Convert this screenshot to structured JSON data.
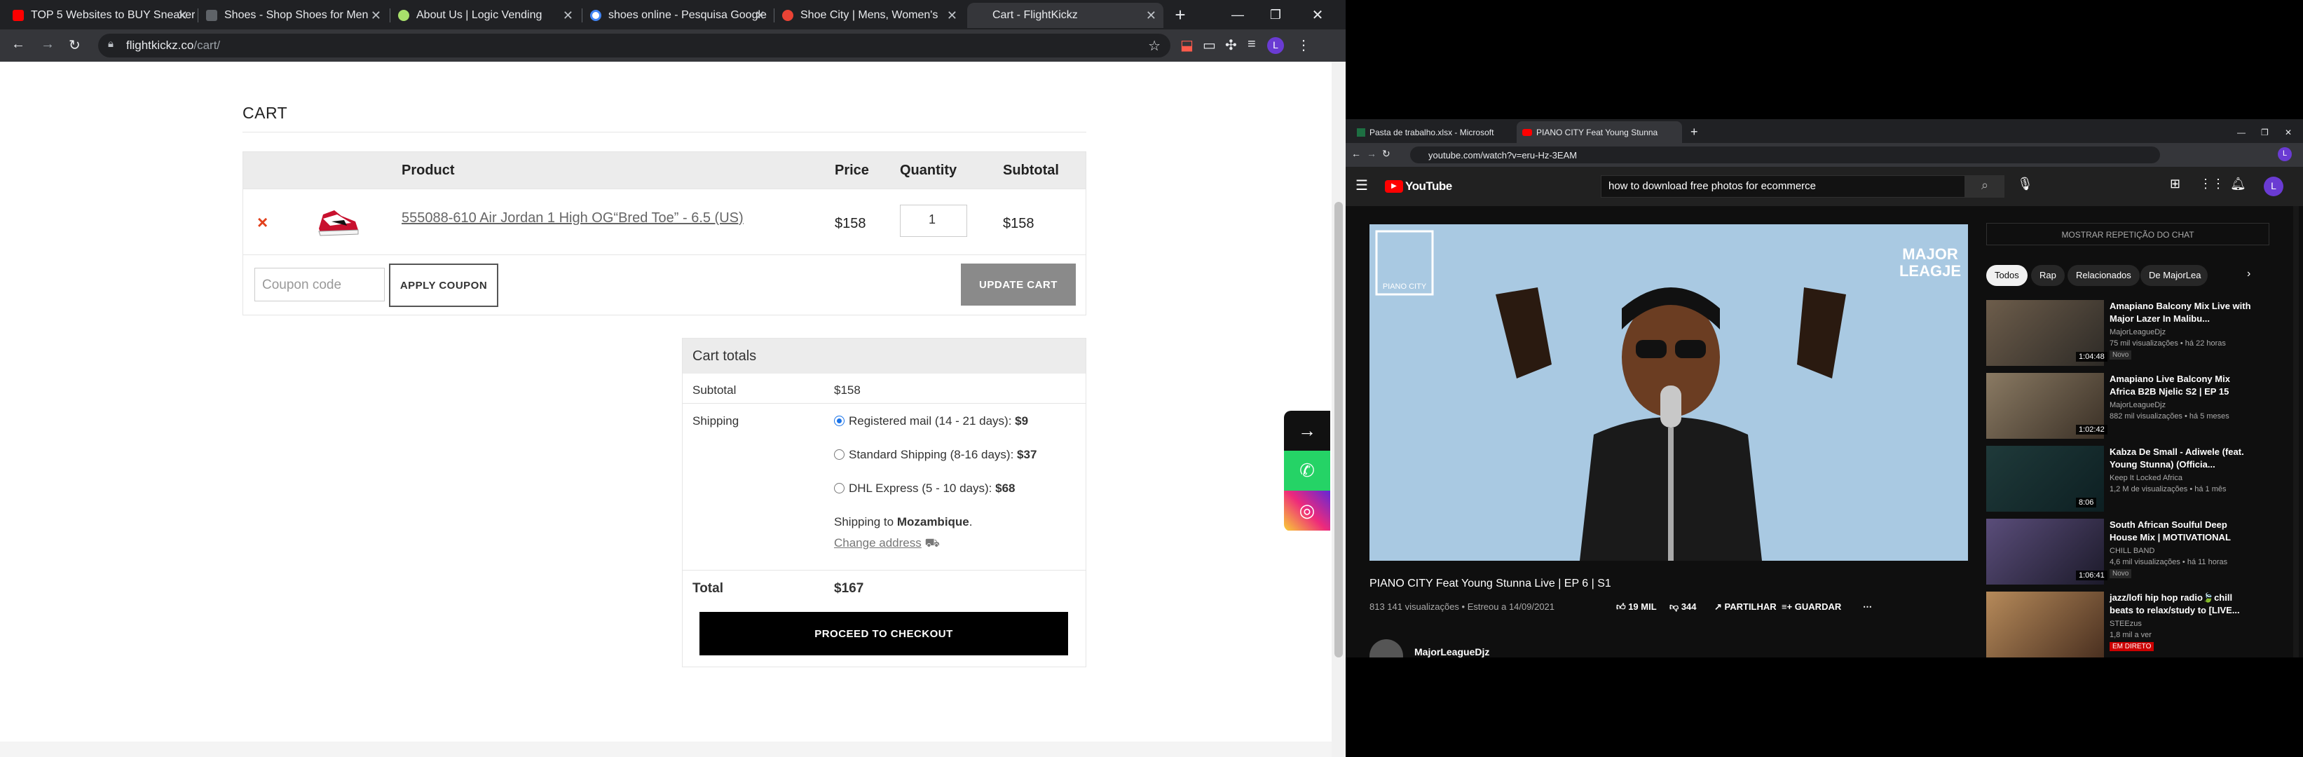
{
  "browser": {
    "tabs": [
      {
        "title": "TOP 5 Websites to BUY Sneakers",
        "color": "#ff0000"
      },
      {
        "title": "Shoes - Shop Shoes for Men",
        "color": "#5f6368"
      },
      {
        "title": "About Us | Logic Vending",
        "color": "#a8e06b"
      },
      {
        "title": "shoes online - Pesquisa Google",
        "color": "#4285f4"
      },
      {
        "title": "Shoe City | Mens, Women's",
        "color": "#ea4335"
      },
      {
        "title": "Cart - FlightKickz",
        "color": ""
      }
    ],
    "url_host": "flightkickz.co",
    "url_path": "/cart/",
    "profile_initial": "L"
  },
  "cart": {
    "title": "CART",
    "headers": {
      "product": "Product",
      "price": "Price",
      "quantity": "Quantity",
      "subtotal": "Subtotal"
    },
    "item": {
      "remove": "×",
      "name": "555088-610 Air Jordan 1 High OG“Bred Toe” - 6.5 (US)",
      "price": "$158",
      "quantity": "1",
      "subtotal": "$158"
    },
    "coupon_placeholder": "Coupon code",
    "apply_label": "APPLY COUPON",
    "update_label": "UPDATE CART"
  },
  "totals": {
    "title": "Cart totals",
    "subtotal_label": "Subtotal",
    "subtotal": "$158",
    "shipping_label": "Shipping",
    "options": [
      {
        "name": "Registered mail (14 - 21 days):",
        "price": "$9",
        "selected": true
      },
      {
        "name": "Standard Shipping (8-16 days):",
        "price": "$37",
        "selected": false
      },
      {
        "name": "DHL Express (5 - 10 days):",
        "price": "$68",
        "selected": false
      }
    ],
    "ship_to_prefix": "Shipping to",
    "ship_to_country": "Mozambique",
    "change_address": "Change address",
    "total_label": "Total",
    "total": "$167",
    "checkout_label": "PROCEED TO CHECKOUT"
  },
  "win2": {
    "tabs": [
      "Pasta de trabalho.xlsx - Microsoft",
      "PIANO CITY Feat Young Stunna"
    ],
    "url": "youtube.com/watch?v=eru-Hz-3EAM",
    "search_value": "how to download free photos for ecommerce",
    "video_title": "PIANO CITY Feat Young Stunna Live | EP 6 | S1",
    "video_meta": "813 141 visualizações • Estreou a 14/09/2021",
    "likes": "19 MIL",
    "dislikes": "344",
    "share": "PARTILHAR",
    "save": "GUARDAR",
    "channel": "MajorLeagueDjz",
    "chat_button": "MOSTRAR REPETIÇÃO DO CHAT",
    "chips": [
      "Todos",
      "Rap",
      "Relacionados",
      "De MajorLea"
    ],
    "recs": [
      {
        "title": "Amapiano Balcony Mix Live with Major Lazer In Malibu...",
        "channel": "MajorLeagueDjz",
        "views": "75 mil visualizações • há 22 horas",
        "badge": "Novo",
        "dur": "1:04:48"
      },
      {
        "title": "Amapiano Live Balcony Mix Africa B2B Njelic S2 | EP 15",
        "channel": "MajorLeagueDjz",
        "views": "882 mil visualizações • há 5 meses",
        "badge": "",
        "dur": "1:02:42"
      },
      {
        "title": "Kabza De Small - Adiwele (feat. Young Stunna) (Officia...",
        "channel": "Keep It Locked Africa",
        "views": "1,2 M de visualizações • há 1 mês",
        "badge": "",
        "dur": "8:06"
      },
      {
        "title": "South African Soulful Deep House Mix | MOTIVATIONAL",
        "channel": "CHILL BAND",
        "views": "4,6 mil visualizações • há 11 horas",
        "badge": "Novo",
        "dur": "1:06:41"
      },
      {
        "title": "jazz/lofi hip hop radio🍃chill beats to relax/study to [LIVE...",
        "channel": "STEEzus",
        "views": "1,8 mil a ver",
        "badge": "EM DIRETO",
        "dur": ""
      }
    ]
  }
}
